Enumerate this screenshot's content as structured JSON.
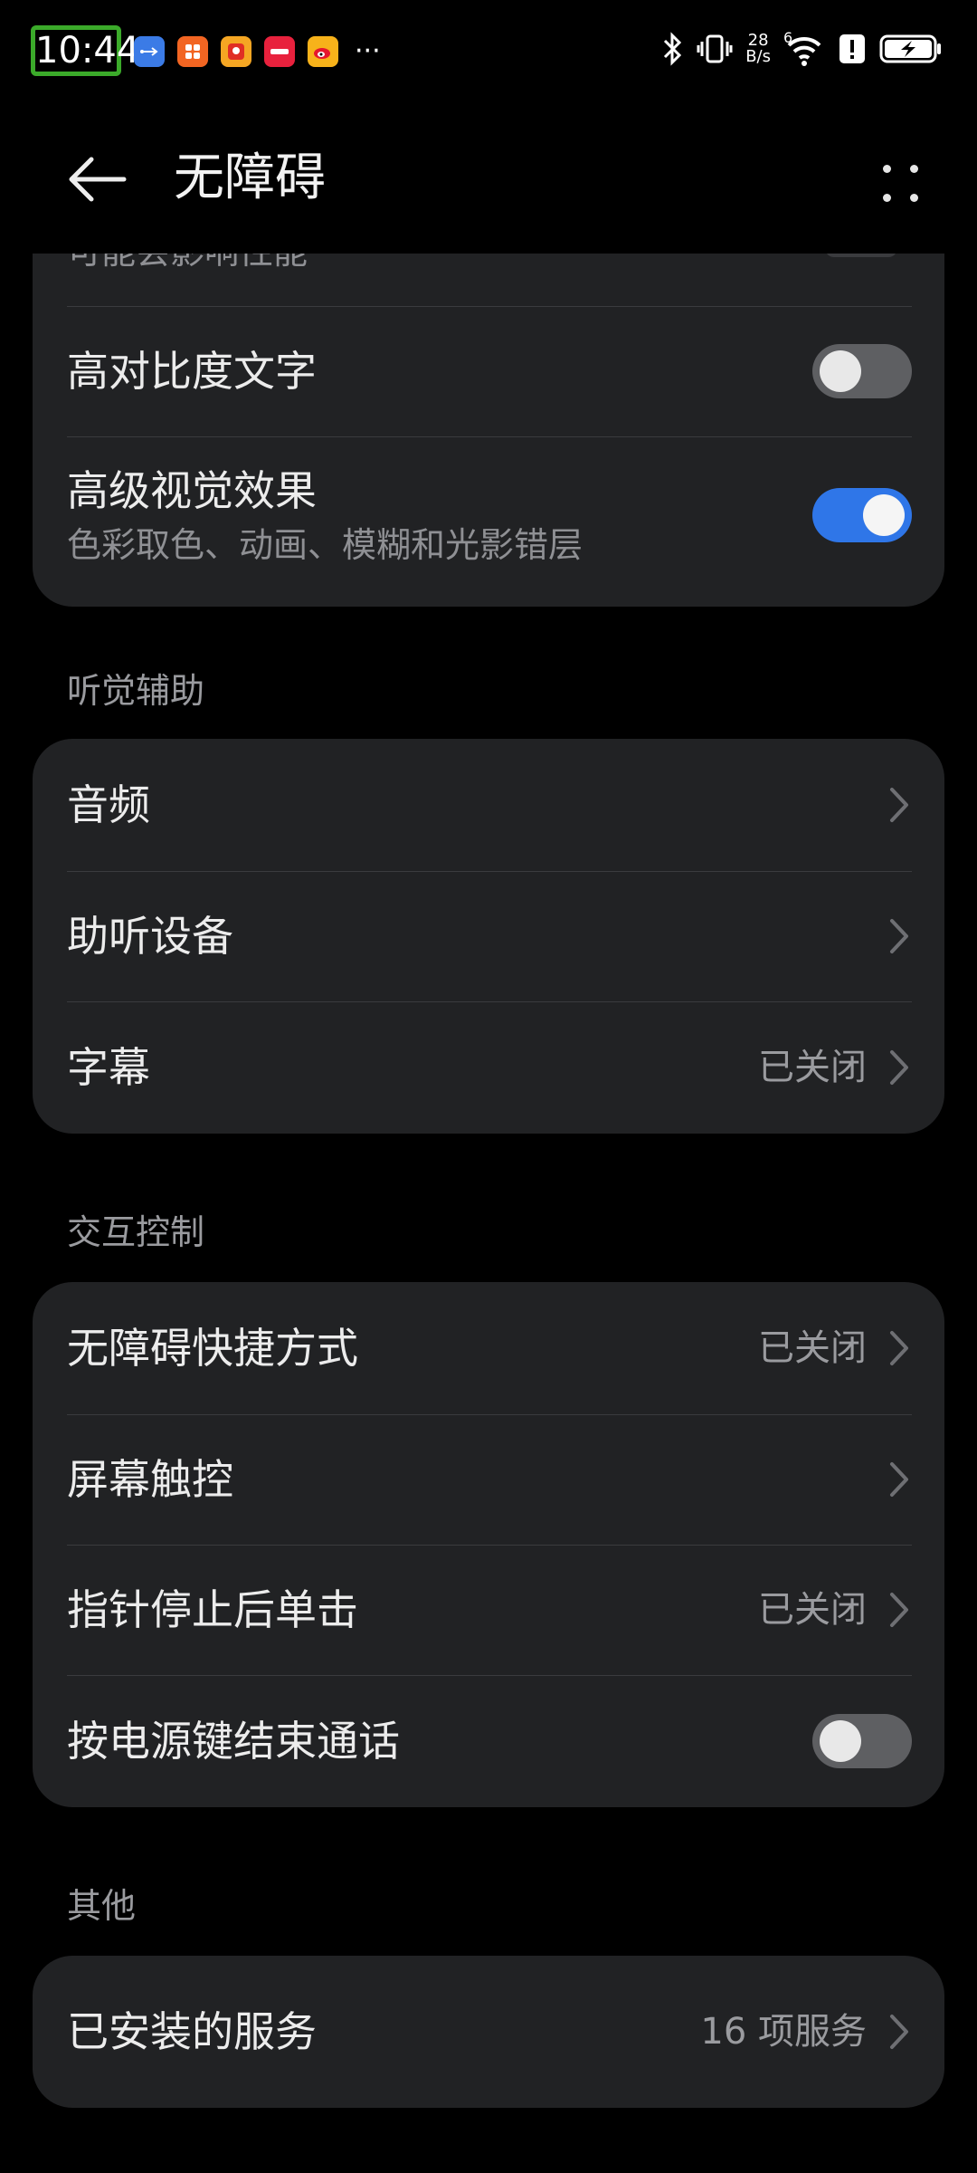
{
  "status_bar": {
    "time": "10:44",
    "notification_icons": [
      "usb-icon",
      "app-icon-orange",
      "app-icon-pinduoduo",
      "app-icon-red",
      "weibo-icon"
    ],
    "more": "···",
    "net_speed_top": "28",
    "net_speed_bottom": "B/s",
    "signal_label": "6"
  },
  "app_bar": {
    "title": "无障碍"
  },
  "top_card": {
    "cut_text": "可能会影响性能",
    "rows": [
      {
        "title": "高对比度文字",
        "toggle": false
      },
      {
        "title": "高级视觉效果",
        "subtitle": "色彩取色、动画、模糊和光影错层",
        "toggle": true
      }
    ]
  },
  "hearing": {
    "label": "听觉辅助",
    "rows": [
      {
        "title": "音频",
        "value": ""
      },
      {
        "title": "助听设备",
        "value": ""
      },
      {
        "title": "字幕",
        "value": "已关闭"
      }
    ]
  },
  "interaction": {
    "label": "交互控制",
    "rows": [
      {
        "title": "无障碍快捷方式",
        "value": "已关闭"
      },
      {
        "title": "屏幕触控",
        "value": ""
      },
      {
        "title": "指针停止后单击",
        "value": "已关闭"
      },
      {
        "title": "按电源键结束通话",
        "toggle": false
      }
    ]
  },
  "other": {
    "label": "其他",
    "rows": [
      {
        "title": "已安装的服务",
        "value": "16 项服务"
      }
    ]
  },
  "colors": {
    "background": "#000000",
    "card": "#212224",
    "accent": "#2F76E8",
    "time_highlight": "#3BAA2A"
  }
}
